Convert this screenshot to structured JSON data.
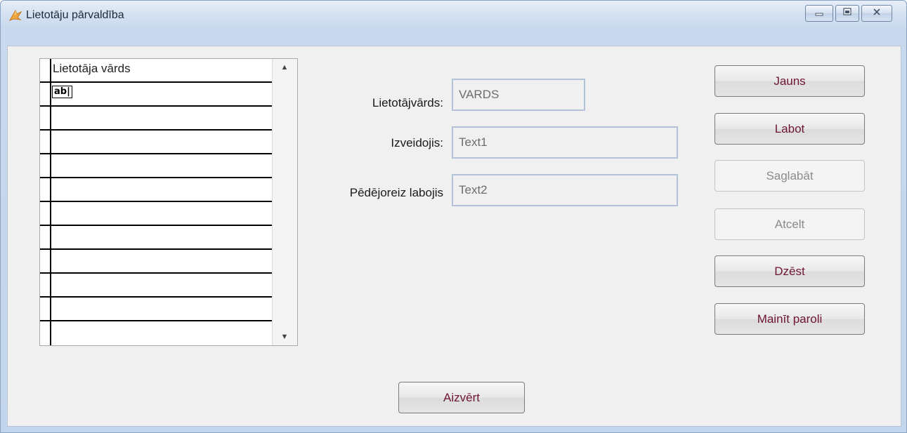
{
  "window": {
    "title": "Lietotāju pārvaldība"
  },
  "grid": {
    "column_header": "Lietotāja vārds",
    "editor_icon_text": "ab|",
    "rows": [
      "",
      "",
      "",
      "",
      "",
      "",
      "",
      "",
      "",
      ""
    ]
  },
  "fields": {
    "username_label": "Lietotājvārds:",
    "username_value": "VARDS",
    "created_by_label": "Izveidojis:",
    "created_by_value": "Text1",
    "last_edited_label": "Pēdējoreiz labojis",
    "last_edited_value": "Text2"
  },
  "buttons": {
    "new": "Jauns",
    "edit": "Labot",
    "save": "Saglabāt",
    "cancel": "Atcelt",
    "delete": "Dzēst",
    "change_password": "Mainīt paroli",
    "close": "Aizvērt"
  },
  "colors": {
    "button_text": "#6e1436",
    "disabled_text": "#8a8a8a",
    "titlebar": "#c9d9ee"
  },
  "icons": {
    "app": "app-logo-icon",
    "minimize": "minimize-icon",
    "maximize": "maximize-icon",
    "close": "close-icon"
  }
}
